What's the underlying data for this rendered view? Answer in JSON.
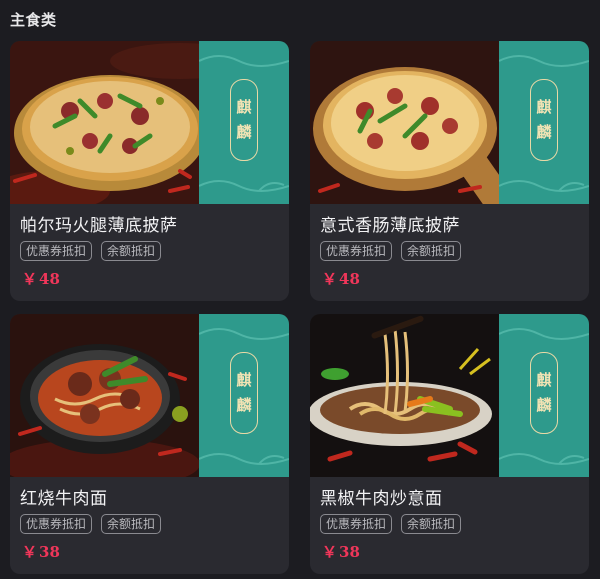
{
  "section": {
    "title": "主食类"
  },
  "brand": {
    "char_top": "麒",
    "char_bottom": "麟"
  },
  "products": [
    {
      "name": "帕尔玛火腿薄底披萨",
      "tags": [
        "优惠券抵扣",
        "余额抵扣"
      ],
      "currency": "￥",
      "price": "48",
      "image_icon": "pizza-image"
    },
    {
      "name": "意式香肠薄底披萨",
      "tags": [
        "优惠券抵扣",
        "余额抵扣"
      ],
      "currency": "￥",
      "price": "48",
      "image_icon": "pizza-image"
    },
    {
      "name": "红烧牛肉面",
      "tags": [
        "优惠券抵扣",
        "余额抵扣"
      ],
      "currency": "￥",
      "price": "38",
      "image_icon": "noodle-bowl-image"
    },
    {
      "name": "黑椒牛肉炒意面",
      "tags": [
        "优惠券抵扣",
        "余额抵扣"
      ],
      "currency": "￥",
      "price": "38",
      "image_icon": "pasta-image"
    }
  ],
  "colors": {
    "background": "#1c1c21",
    "card": "#2a2a30",
    "brand_panel": "#2e9a8c",
    "price": "#f0365a"
  }
}
